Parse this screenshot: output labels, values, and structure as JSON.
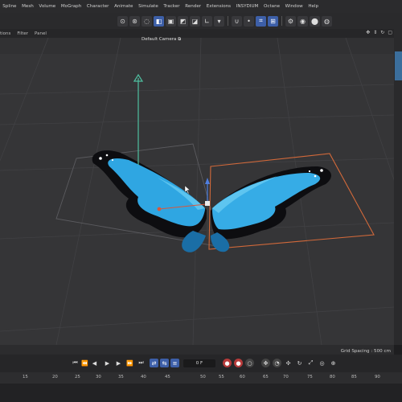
{
  "menu": [
    "Spline",
    "Mesh",
    "Volume",
    "MoGraph",
    "Character",
    "Animate",
    "Simulate",
    "Tracker",
    "Render",
    "Extensions",
    "INSYDIUM",
    "Octane",
    "Window",
    "Help"
  ],
  "viewport_menu": [
    "tions",
    "Filter",
    "Panel"
  ],
  "camera_label": "Default Camera",
  "camera_icon": "camera-link-icon",
  "viewport_nav_icons": [
    "move-view-icon",
    "zoom-view-icon",
    "rotate-view-icon",
    "toggle-view-icon"
  ],
  "grid_spacing": "Grid Spacing : 500 cm",
  "frame_field": "0 F",
  "timeline_ticks": [
    "15",
    "20",
    "25",
    "30",
    "35",
    "40",
    "45",
    "50",
    "55",
    "60",
    "65",
    "70",
    "75",
    "80",
    "85",
    "90"
  ],
  "object_description": "blue morpho butterfly model",
  "colors": {
    "accent": "#3d5fa8",
    "record": "#b63a3a",
    "selection_box": "#d2693a",
    "y_axis": "#4fbfa0",
    "x_axis": "#d8583c"
  }
}
